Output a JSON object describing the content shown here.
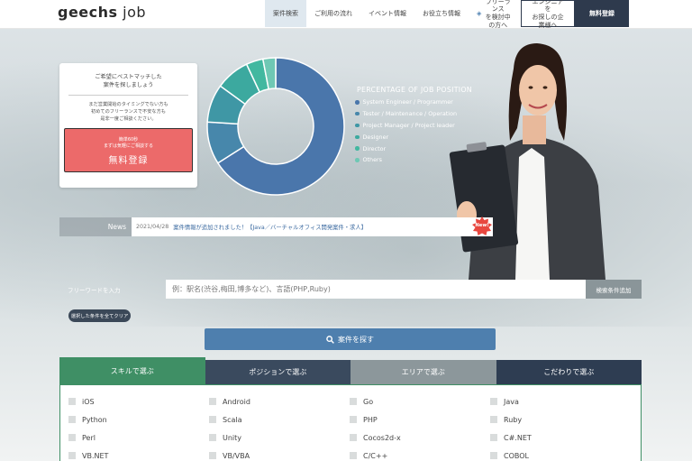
{
  "header": {
    "logo": {
      "bold": "geechs",
      "light": "job"
    },
    "nav": [
      "案件検索",
      "ご利用の流れ",
      "イベント情報",
      "お役立ち情報"
    ],
    "freelance": {
      "line1": "フリーランス",
      "line2": "を検討中の方へ"
    },
    "engineer": {
      "line1": "エンジニアを",
      "line2": "お探しの企業様へ"
    },
    "register": "無料登録"
  },
  "left_card": {
    "title1": "ご希望にベストマッチした",
    "title2": "案件を探しましょう",
    "sub1": "まだ営業開始のタイミングでない方も",
    "sub2": "初めてのフリーランスで不安な方も",
    "sub3": "是非一度ご相談ください。",
    "btn_small1": "簡単60秒",
    "btn_small2": "まずは気軽にご相談する",
    "btn_large": "無料登録"
  },
  "chart_data": {
    "type": "pie",
    "title": "PERCENTAGE OF JOB POSITION",
    "categories": [
      "System Engineer / Programmer",
      "Tester / Maintenance / Operation",
      "Project Manager / Project leader",
      "Designer",
      "Director",
      "Others"
    ],
    "values": [
      66,
      10,
      9,
      8,
      4,
      3
    ],
    "colors": [
      "#4a76ab",
      "#4787ab",
      "#3f97a5",
      "#3ca99f",
      "#42b8a0",
      "#6fc8b4"
    ]
  },
  "news": {
    "label": "News",
    "date": "2021/04/28",
    "text": "案件情報が追加されました！【Java／バーチャルオフィス開発案件・求人】",
    "badge": "New!"
  },
  "search": {
    "freeword_label": "フリーワードを入力",
    "placeholder": "例：駅名(渋谷,梅田,博多など)、言語(PHP,Ruby)",
    "add_button": "検索条件追加",
    "clear_button": "選択した条件を全てクリア",
    "search_button": "案件を探す"
  },
  "tabs": [
    "スキルで選ぶ",
    "ポジションで選ぶ",
    "エリアで選ぶ",
    "こだわりで選ぶ"
  ],
  "skills": [
    "iOS",
    "Android",
    "Go",
    "Java",
    "Python",
    "Scala",
    "PHP",
    "Ruby",
    "Perl",
    "Unity",
    "Cocos2d-x",
    "C#.NET",
    "VB.NET",
    "VB/VBA",
    "C/C++",
    "COBOL"
  ],
  "colors": {
    "accent": "#3f8f65",
    "navy": "#2e3a4d",
    "search_blue": "#4e7fae",
    "cta_red": "#ec6a6a"
  }
}
